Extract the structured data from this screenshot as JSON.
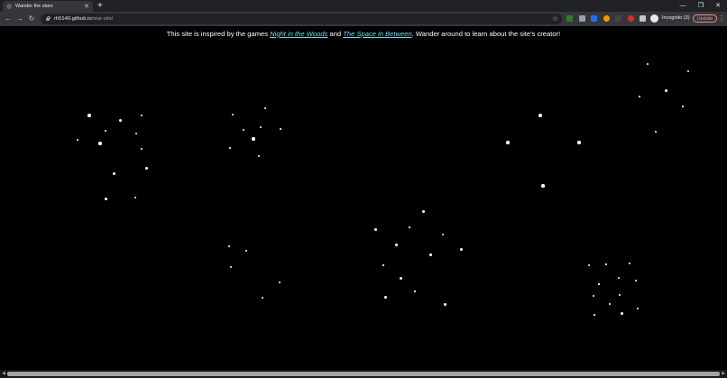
{
  "browser": {
    "tab_title": "Wander the stars",
    "tab_close": "✕",
    "new_tab": "+",
    "window_controls": {
      "minimize": "—",
      "restore": "❐",
      "close": "✕"
    },
    "nav": {
      "back": "←",
      "forward": "→",
      "reload": "↻"
    },
    "url_host": "rh5140.github.io",
    "url_path": "/star-site/",
    "bookmark_star": "☆",
    "incognito_label": "Incognito (3)",
    "update_label": "Update",
    "menu": "⋮",
    "extensions": [
      {
        "name": "ext-green-badge",
        "color": "#2e7d32"
      },
      {
        "name": "ext-grey-square",
        "color": "#9aa0a6"
      },
      {
        "name": "ext-blue-square",
        "color": "#1a73e8"
      },
      {
        "name": "ext-orange-circle",
        "color": "#f29900"
      },
      {
        "name": "ext-dark-square",
        "color": "#444746"
      },
      {
        "name": "ext-red-stop",
        "color": "#d93025"
      },
      {
        "name": "puzzle-icon",
        "color": "#c4c7c5"
      }
    ]
  },
  "page": {
    "intro_before": "This site is inspired by the games ",
    "link_1": "Night in the Woods",
    "intro_and": " and ",
    "link_2": "The Space in Between",
    "intro_after": ". Wander around to learn about the site's creator!",
    "background": "#000000",
    "link_color": "#7fd8ea"
  },
  "scrollbar": {
    "left_arrow": "◀",
    "right_arrow": "▶"
  }
}
